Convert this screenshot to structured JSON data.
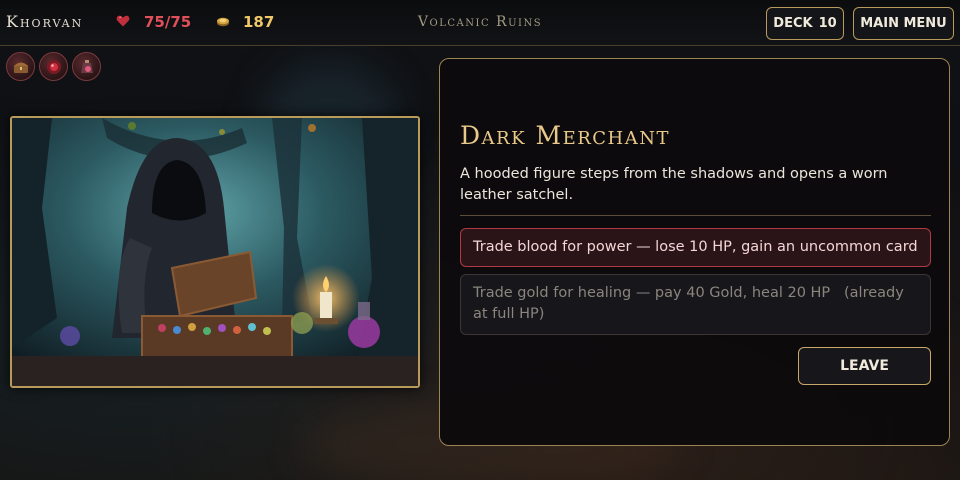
{
  "colors": {
    "accent_gold": "#b89a5a",
    "hp_red": "#e0505a",
    "gold_yellow": "#efc868",
    "title_gold": "#e9c98a",
    "option_highlight_border": "#b03a44"
  },
  "header": {
    "hero_name": "Khorvan",
    "hp_icon": "heart-icon",
    "hp": "75/75",
    "gold_icon": "gold-coin-icon",
    "gold": "187",
    "location": "Volcanic Ruins",
    "deck_label": "DECK",
    "deck_count": "10",
    "menu_label": "MAIN MENU"
  },
  "relics": [
    {
      "icon": "treasure-chest-relic-icon"
    },
    {
      "icon": "blood-orb-relic-icon"
    },
    {
      "icon": "potion-satchel-relic-icon"
    }
  ],
  "event": {
    "title": "Dark Merchant",
    "description": "A hooded figure steps from the shadows and opens a worn leather satchel.",
    "options": [
      {
        "label": "Trade blood for power — lose 10 HP, gain an uncommon card",
        "state": "available"
      },
      {
        "label": "Trade gold for healing — pay 40 Gold, heal 20 HP   (already at full HP)",
        "state": "disabled"
      }
    ],
    "leave_label": "LEAVE"
  }
}
